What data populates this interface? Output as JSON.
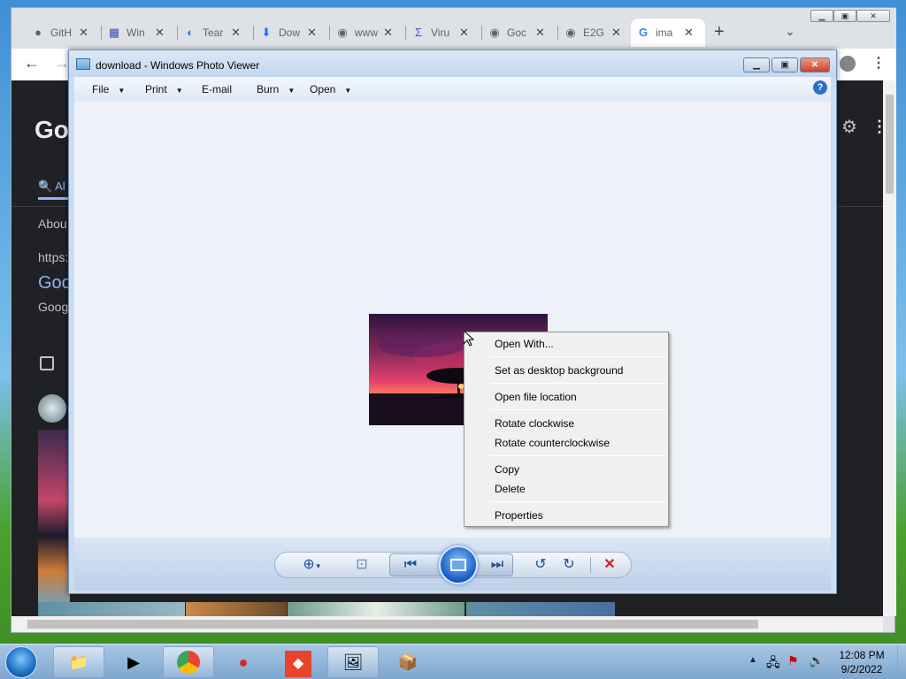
{
  "browser": {
    "tabs": [
      {
        "icon": "github-icon",
        "glyph": "●",
        "label": "GitH"
      },
      {
        "icon": "window-icon",
        "glyph": "▦",
        "label": "Win"
      },
      {
        "icon": "teams-icon",
        "glyph": "◐",
        "label": "Tear"
      },
      {
        "icon": "download-icon",
        "glyph": "⬇",
        "label": "Dow"
      },
      {
        "icon": "globe-icon",
        "glyph": "◉",
        "label": "www"
      },
      {
        "icon": "virustotal-icon",
        "glyph": "Σ",
        "label": "Viru"
      },
      {
        "icon": "globe-icon",
        "glyph": "◉",
        "label": "Goc"
      },
      {
        "icon": "globe-icon",
        "glyph": "◉",
        "label": "E2G"
      },
      {
        "icon": "google-icon",
        "glyph": "G",
        "label": "ima"
      }
    ],
    "new_tab": "+",
    "tab_dropdown": "⌄",
    "page": {
      "logo": "Go",
      "all_tab": "Al",
      "about": "Abou",
      "result_url": "https:",
      "result_title": "Goo",
      "result_snippet": "Goog"
    }
  },
  "photo_viewer": {
    "title": "download - Windows Photo Viewer",
    "menu": [
      "File",
      "Print",
      "E-mail",
      "Burn",
      "Open"
    ],
    "help": "?"
  },
  "context_menu": {
    "items": [
      "Open With...",
      "Set as desktop background",
      "Open file location",
      "Rotate clockwise",
      "Rotate counterclockwise",
      "Copy",
      "Delete",
      "Properties"
    ]
  },
  "taskbar": {
    "time": "12:08 PM",
    "date": "9/2/2022"
  },
  "colors": {
    "accent": "#1f4f98",
    "dark_page": "#202124",
    "close_red": "#c8442b"
  }
}
